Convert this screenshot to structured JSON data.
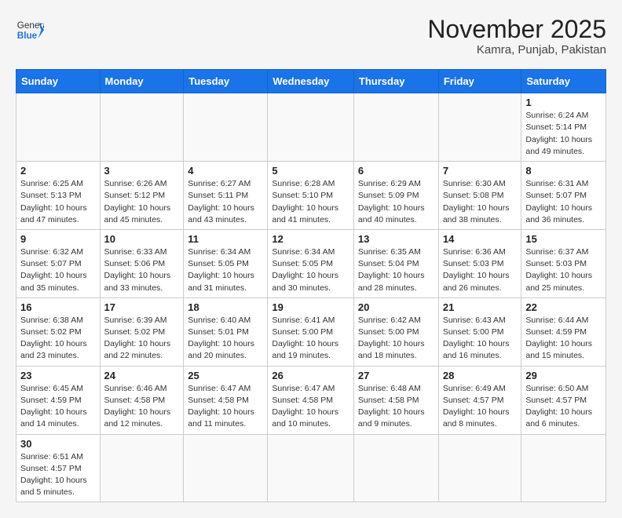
{
  "header": {
    "logo_general": "General",
    "logo_blue": "Blue",
    "month_title": "November 2025",
    "location": "Kamra, Punjab, Pakistan"
  },
  "weekdays": [
    "Sunday",
    "Monday",
    "Tuesday",
    "Wednesday",
    "Thursday",
    "Friday",
    "Saturday"
  ],
  "weeks": [
    [
      {
        "day": "",
        "info": ""
      },
      {
        "day": "",
        "info": ""
      },
      {
        "day": "",
        "info": ""
      },
      {
        "day": "",
        "info": ""
      },
      {
        "day": "",
        "info": ""
      },
      {
        "day": "",
        "info": ""
      },
      {
        "day": "1",
        "info": "Sunrise: 6:24 AM\nSunset: 5:14 PM\nDaylight: 10 hours and 49 minutes."
      }
    ],
    [
      {
        "day": "2",
        "info": "Sunrise: 6:25 AM\nSunset: 5:13 PM\nDaylight: 10 hours and 47 minutes."
      },
      {
        "day": "3",
        "info": "Sunrise: 6:26 AM\nSunset: 5:12 PM\nDaylight: 10 hours and 45 minutes."
      },
      {
        "day": "4",
        "info": "Sunrise: 6:27 AM\nSunset: 5:11 PM\nDaylight: 10 hours and 43 minutes."
      },
      {
        "day": "5",
        "info": "Sunrise: 6:28 AM\nSunset: 5:10 PM\nDaylight: 10 hours and 41 minutes."
      },
      {
        "day": "6",
        "info": "Sunrise: 6:29 AM\nSunset: 5:09 PM\nDaylight: 10 hours and 40 minutes."
      },
      {
        "day": "7",
        "info": "Sunrise: 6:30 AM\nSunset: 5:08 PM\nDaylight: 10 hours and 38 minutes."
      },
      {
        "day": "8",
        "info": "Sunrise: 6:31 AM\nSunset: 5:07 PM\nDaylight: 10 hours and 36 minutes."
      }
    ],
    [
      {
        "day": "9",
        "info": "Sunrise: 6:32 AM\nSunset: 5:07 PM\nDaylight: 10 hours and 35 minutes."
      },
      {
        "day": "10",
        "info": "Sunrise: 6:33 AM\nSunset: 5:06 PM\nDaylight: 10 hours and 33 minutes."
      },
      {
        "day": "11",
        "info": "Sunrise: 6:34 AM\nSunset: 5:05 PM\nDaylight: 10 hours and 31 minutes."
      },
      {
        "day": "12",
        "info": "Sunrise: 6:34 AM\nSunset: 5:05 PM\nDaylight: 10 hours and 30 minutes."
      },
      {
        "day": "13",
        "info": "Sunrise: 6:35 AM\nSunset: 5:04 PM\nDaylight: 10 hours and 28 minutes."
      },
      {
        "day": "14",
        "info": "Sunrise: 6:36 AM\nSunset: 5:03 PM\nDaylight: 10 hours and 26 minutes."
      },
      {
        "day": "15",
        "info": "Sunrise: 6:37 AM\nSunset: 5:03 PM\nDaylight: 10 hours and 25 minutes."
      }
    ],
    [
      {
        "day": "16",
        "info": "Sunrise: 6:38 AM\nSunset: 5:02 PM\nDaylight: 10 hours and 23 minutes."
      },
      {
        "day": "17",
        "info": "Sunrise: 6:39 AM\nSunset: 5:02 PM\nDaylight: 10 hours and 22 minutes."
      },
      {
        "day": "18",
        "info": "Sunrise: 6:40 AM\nSunset: 5:01 PM\nDaylight: 10 hours and 20 minutes."
      },
      {
        "day": "19",
        "info": "Sunrise: 6:41 AM\nSunset: 5:00 PM\nDaylight: 10 hours and 19 minutes."
      },
      {
        "day": "20",
        "info": "Sunrise: 6:42 AM\nSunset: 5:00 PM\nDaylight: 10 hours and 18 minutes."
      },
      {
        "day": "21",
        "info": "Sunrise: 6:43 AM\nSunset: 5:00 PM\nDaylight: 10 hours and 16 minutes."
      },
      {
        "day": "22",
        "info": "Sunrise: 6:44 AM\nSunset: 4:59 PM\nDaylight: 10 hours and 15 minutes."
      }
    ],
    [
      {
        "day": "23",
        "info": "Sunrise: 6:45 AM\nSunset: 4:59 PM\nDaylight: 10 hours and 14 minutes."
      },
      {
        "day": "24",
        "info": "Sunrise: 6:46 AM\nSunset: 4:58 PM\nDaylight: 10 hours and 12 minutes."
      },
      {
        "day": "25",
        "info": "Sunrise: 6:47 AM\nSunset: 4:58 PM\nDaylight: 10 hours and 11 minutes."
      },
      {
        "day": "26",
        "info": "Sunrise: 6:47 AM\nSunset: 4:58 PM\nDaylight: 10 hours and 10 minutes."
      },
      {
        "day": "27",
        "info": "Sunrise: 6:48 AM\nSunset: 4:58 PM\nDaylight: 10 hours and 9 minutes."
      },
      {
        "day": "28",
        "info": "Sunrise: 6:49 AM\nSunset: 4:57 PM\nDaylight: 10 hours and 8 minutes."
      },
      {
        "day": "29",
        "info": "Sunrise: 6:50 AM\nSunset: 4:57 PM\nDaylight: 10 hours and 6 minutes."
      }
    ],
    [
      {
        "day": "30",
        "info": "Sunrise: 6:51 AM\nSunset: 4:57 PM\nDaylight: 10 hours and 5 minutes."
      },
      {
        "day": "",
        "info": ""
      },
      {
        "day": "",
        "info": ""
      },
      {
        "day": "",
        "info": ""
      },
      {
        "day": "",
        "info": ""
      },
      {
        "day": "",
        "info": ""
      },
      {
        "day": "",
        "info": ""
      }
    ]
  ]
}
